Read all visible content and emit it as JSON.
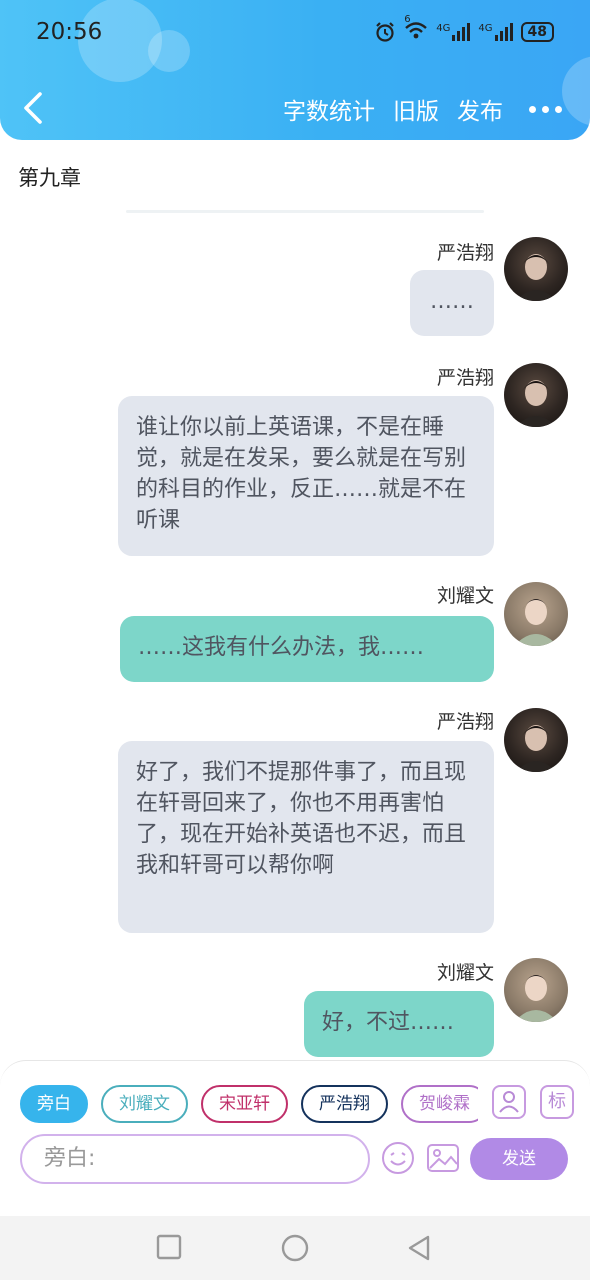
{
  "status_bar": {
    "time": "20:56",
    "battery": "48",
    "network_labels": [
      "6",
      "4G",
      "4G"
    ]
  },
  "header": {
    "actions": {
      "word_count": "字数统计",
      "old_version": "旧版",
      "publish": "发布"
    },
    "colors": {
      "gradient_start": "#4fc3f7",
      "gradient_end": "#3aa6f5"
    }
  },
  "chapter": {
    "title": "第九章"
  },
  "messages": [
    {
      "speaker": "严浩翔",
      "text": "……",
      "style": "gray"
    },
    {
      "speaker": "严浩翔",
      "text": "谁让你以前上英语课，不是在睡觉，就是在发呆，要么就是在写别的科目的作业，反正……就是不在听课",
      "style": "gray"
    },
    {
      "speaker": "刘耀文",
      "text": "……这我有什么办法，我……",
      "style": "teal"
    },
    {
      "speaker": "严浩翔",
      "text": "好了，我们不提那件事了，而且现在轩哥回来了，你也不用再害怕了，现在开始补英语也不迟，而且我和轩哥可以帮你啊",
      "style": "gray"
    },
    {
      "speaker": "刘耀文",
      "text": "好，不过……",
      "style": "teal"
    }
  ],
  "roles": [
    {
      "label": "旁白",
      "color": "#36b4ec",
      "active": true
    },
    {
      "label": "刘耀文",
      "color": "#4aaebc",
      "active": false
    },
    {
      "label": "宋亚轩",
      "color": "#c0306a",
      "active": false
    },
    {
      "label": "严浩翔",
      "color": "#14325c",
      "active": false
    },
    {
      "label": "贺峻霖",
      "color": "#b070c8",
      "active": false
    }
  ],
  "tools": {
    "character_icon": "person-icon",
    "tag_label": "标"
  },
  "input": {
    "placeholder": "旁白:",
    "send_label": "发送"
  },
  "nav": {
    "icons": [
      "square-icon",
      "circle-icon",
      "triangle-back-icon"
    ]
  }
}
